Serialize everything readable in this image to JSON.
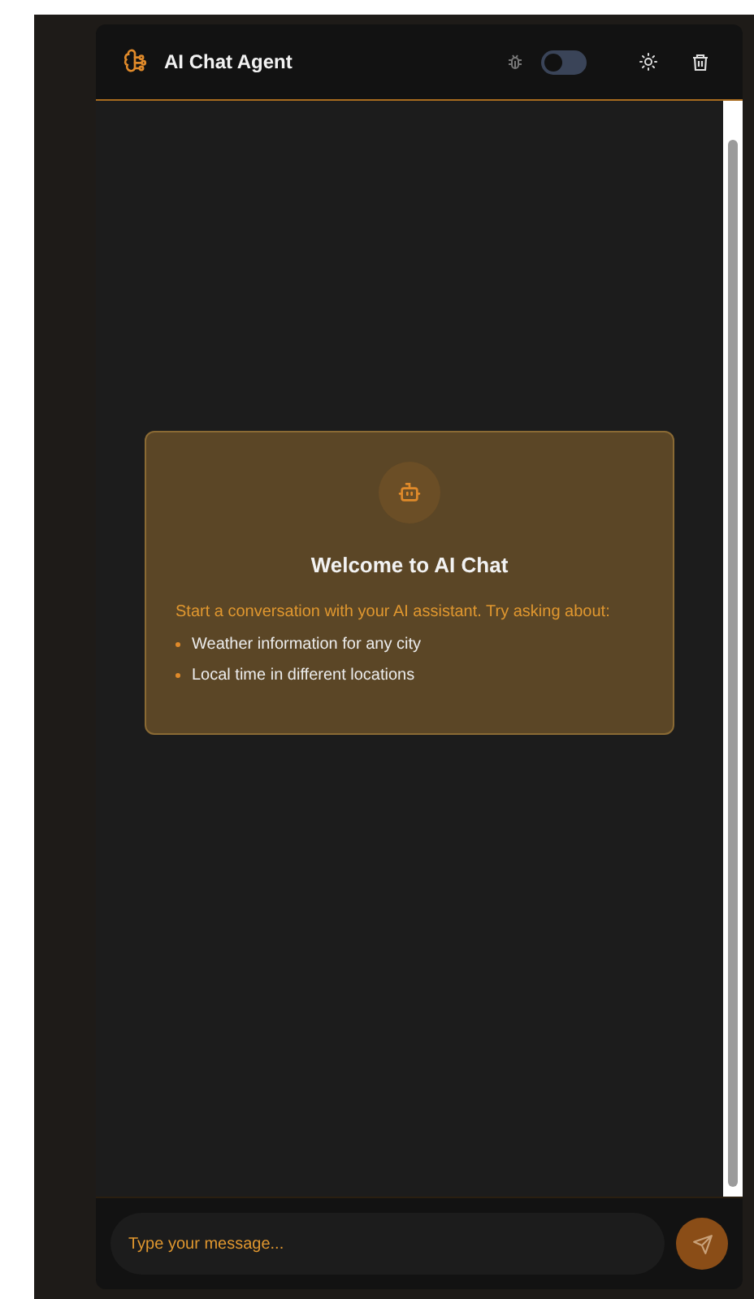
{
  "header": {
    "title": "AI Chat Agent",
    "debug": {
      "on": false
    }
  },
  "welcome": {
    "title": "Welcome to AI Chat",
    "subtitle": "Start a conversation with your AI assistant. Try asking about:",
    "suggestions": [
      "Weather information for any city",
      "Local time in different locations"
    ]
  },
  "composer": {
    "placeholder": "Type your message..."
  }
}
